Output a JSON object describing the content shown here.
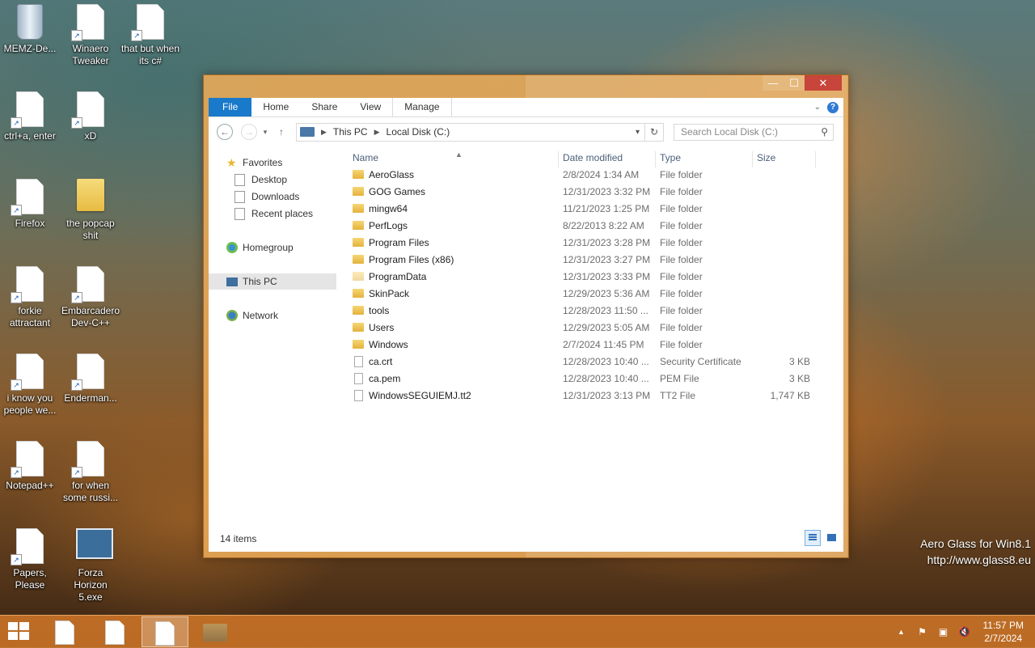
{
  "desktop_icons": [
    {
      "id": "recycle-bin",
      "label": "MEMZ-De...",
      "kind": "bin"
    },
    {
      "id": "winaero",
      "label": "Winaero Tweaker",
      "kind": "doc"
    },
    {
      "id": "that-but",
      "label": "that but when its c#",
      "kind": "doc"
    },
    {
      "id": "ctrl-a",
      "label": "ctrl+a, enter",
      "kind": "doc"
    },
    {
      "id": "xd",
      "label": "xD",
      "kind": "doc"
    },
    {
      "id": "firefox",
      "label": "Firefox",
      "kind": "doc"
    },
    {
      "id": "popcap",
      "label": "the popcap shit",
      "kind": "folder"
    },
    {
      "id": "forkie",
      "label": "forkie attractant",
      "kind": "doc"
    },
    {
      "id": "embarcadero",
      "label": "Embarcadero Dev-C++",
      "kind": "doc"
    },
    {
      "id": "i-know",
      "label": "i know you people we...",
      "kind": "doc"
    },
    {
      "id": "enderman",
      "label": "Enderman...",
      "kind": "doc"
    },
    {
      "id": "notepadpp",
      "label": "Notepad++",
      "kind": "doc"
    },
    {
      "id": "for-when",
      "label": "for when some russi...",
      "kind": "doc"
    },
    {
      "id": "papers",
      "label": "Papers, Please",
      "kind": "doc"
    },
    {
      "id": "forza",
      "label": "Forza Horizon 5.exe",
      "kind": "exe"
    }
  ],
  "window": {
    "controls": {
      "minimize": "—",
      "maximize": "☐",
      "close": "✕"
    },
    "ribbon_tabs": [
      "File",
      "Home",
      "Share",
      "View",
      "Manage"
    ],
    "help_label": "?",
    "address": {
      "crumbs": [
        "This PC",
        "Local Disk (C:)"
      ]
    },
    "search_placeholder": "Search Local Disk (C:)",
    "sidebar": {
      "favorites": "Favorites",
      "fav_items": [
        "Desktop",
        "Downloads",
        "Recent places"
      ],
      "homegroup": "Homegroup",
      "this_pc": "This PC",
      "network": "Network"
    },
    "columns": {
      "name": "Name",
      "date": "Date modified",
      "type": "Type",
      "size": "Size"
    },
    "files": [
      {
        "name": "AeroGlass",
        "date": "2/8/2024 1:34 AM",
        "type": "File folder",
        "size": "",
        "kind": "folder"
      },
      {
        "name": "GOG Games",
        "date": "12/31/2023 3:32 PM",
        "type": "File folder",
        "size": "",
        "kind": "folder"
      },
      {
        "name": "mingw64",
        "date": "11/21/2023 1:25 PM",
        "type": "File folder",
        "size": "",
        "kind": "folder"
      },
      {
        "name": "PerfLogs",
        "date": "8/22/2013 8:22 AM",
        "type": "File folder",
        "size": "",
        "kind": "folder"
      },
      {
        "name": "Program Files",
        "date": "12/31/2023 3:28 PM",
        "type": "File folder",
        "size": "",
        "kind": "folder"
      },
      {
        "name": "Program Files (x86)",
        "date": "12/31/2023 3:27 PM",
        "type": "File folder",
        "size": "",
        "kind": "folder"
      },
      {
        "name": "ProgramData",
        "date": "12/31/2023 3:33 PM",
        "type": "File folder",
        "size": "",
        "kind": "folder-hidden"
      },
      {
        "name": "SkinPack",
        "date": "12/29/2023 5:36 AM",
        "type": "File folder",
        "size": "",
        "kind": "folder"
      },
      {
        "name": "tools",
        "date": "12/28/2023 11:50 ...",
        "type": "File folder",
        "size": "",
        "kind": "folder"
      },
      {
        "name": "Users",
        "date": "12/29/2023 5:05 AM",
        "type": "File folder",
        "size": "",
        "kind": "folder"
      },
      {
        "name": "Windows",
        "date": "2/7/2024 11:45 PM",
        "type": "File folder",
        "size": "",
        "kind": "folder"
      },
      {
        "name": "ca.crt",
        "date": "12/28/2023 10:40 ...",
        "type": "Security Certificate",
        "size": "3 KB",
        "kind": "doc"
      },
      {
        "name": "ca.pem",
        "date": "12/28/2023 10:40 ...",
        "type": "PEM File",
        "size": "3 KB",
        "kind": "doc"
      },
      {
        "name": "WindowsSEGUIEMJ.tt2",
        "date": "12/31/2023 3:13 PM",
        "type": "TT2 File",
        "size": "1,747 KB",
        "kind": "doc"
      }
    ],
    "status_count": "14 items"
  },
  "watermark": {
    "line1": "Aero Glass for Win8.1",
    "line2": "http://www.glass8.eu"
  },
  "taskbar": {
    "time": "11:57 PM",
    "date": "2/7/2024",
    "tray_icons": [
      "show-hidden-icon",
      "action-center-flag-icon",
      "network-icon",
      "volume-muted-icon"
    ]
  },
  "colors": {
    "accent_file_tab": "#1979ca",
    "close_button": "#c7453a",
    "window_frame": "#e8a858"
  }
}
